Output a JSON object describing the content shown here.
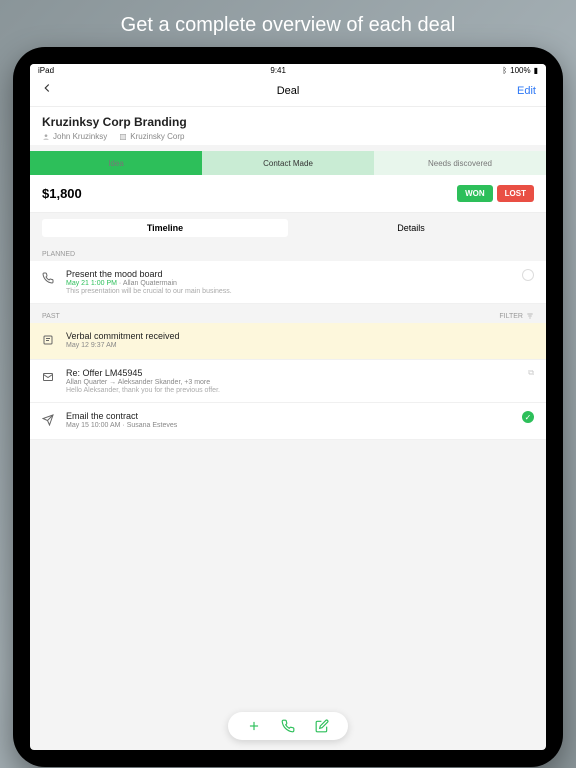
{
  "promo": {
    "heading": "Get a complete overview of each deal"
  },
  "status_bar": {
    "carrier": "iPad",
    "time": "9:41",
    "bt": "100%"
  },
  "nav": {
    "title": "Deal",
    "edit": "Edit"
  },
  "deal": {
    "title": "Kruzinksy Corp Branding",
    "person": "John Kruzinksy",
    "org": "Kruzinsky Corp",
    "amount": "$1,800"
  },
  "stages": {
    "idea": "Idea",
    "contact": "Contact Made",
    "needs": "Needs discovered"
  },
  "buttons": {
    "won": "WON",
    "lost": "LOST"
  },
  "tabs": {
    "timeline": "Timeline",
    "details": "Details"
  },
  "sections": {
    "planned": "PLANNED",
    "past": "PAST",
    "filter": "Filter"
  },
  "items": {
    "planned1": {
      "title": "Present the mood board",
      "date": "May 21 1:00 PM",
      "person": "Allan Quatermain",
      "note": "This presentation will be crucial to our main business."
    },
    "past1": {
      "title": "Verbal commitment received",
      "sub": "May 12 9:37 AM"
    },
    "past2": {
      "title": "Re: Offer LM45945",
      "sub": "Allan Quarter → Aleksander Skander, +3 more",
      "note": "Hello Aleksander, thank you for the previous offer."
    },
    "past3": {
      "title": "Email the contract",
      "sub": "May 15 10:00 AM · Susana Esteves"
    }
  }
}
